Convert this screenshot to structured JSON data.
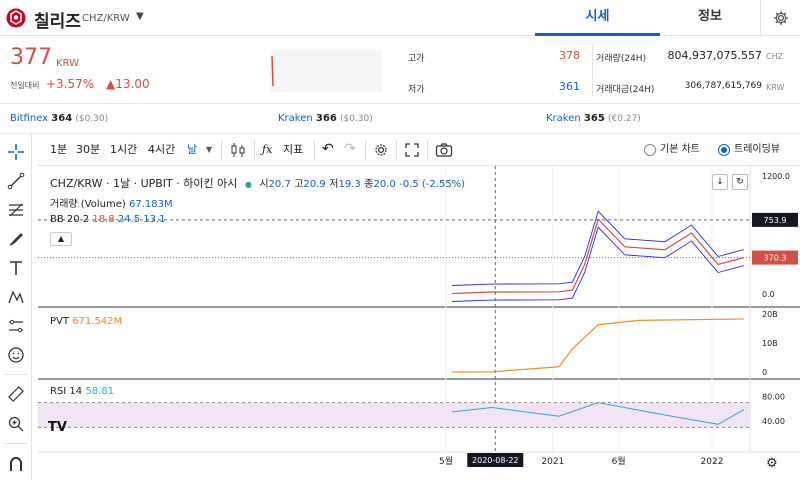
{
  "header": {
    "coin_name": "칠리즈",
    "pair": "CHZ/KRW",
    "tab_quote": "시세",
    "tab_info": "정보"
  },
  "summary": {
    "price": "377",
    "price_unit": "KRW",
    "change_label": "전일대비",
    "change_pct": "+3.57%",
    "change_abs": "▲13.00",
    "high_label": "고가",
    "high": "378",
    "low_label": "저가",
    "low": "361",
    "volume_label": "거래량(24H)",
    "volume": "804,937,075.557",
    "volume_unit": "CHZ",
    "amount_label": "거래대금(24H)",
    "amount": "306,787,615,769",
    "amount_unit": "KRW"
  },
  "exchanges": [
    {
      "name": "Bitfinex",
      "price": "364",
      "diff": "($0.30)"
    },
    {
      "name": "Kraken",
      "price": "366",
      "diff": "($0.30)"
    },
    {
      "name": "Kraken",
      "price": "365",
      "diff": "(€0.27)"
    }
  ],
  "toolbar": {
    "intervals": [
      "1분",
      "30분",
      "1시간",
      "4시간",
      "날"
    ],
    "indicators_label": "지표",
    "basic_chart": "기본 차트",
    "trading_view": "트레이딩뷰"
  },
  "legend": {
    "symbol": "CHZ/KRW · 1날 · UPBIT · 하이킨 아시",
    "o_lbl": "시",
    "o": "20.7",
    "h_lbl": "고",
    "h": "20.9",
    "l_lbl": "저",
    "l": "19.3",
    "c_lbl": "종",
    "c": "20.0",
    "chg": "-0.5 (-2.55%)",
    "volume_label": "거래량 (Volume)",
    "volume": "67.183M",
    "bb_label": "BB 20 2",
    "bb1": "18.8",
    "bb2": "24.5",
    "bb3": "13.1",
    "pvt_label": "PVT",
    "pvt": "671.542M",
    "rsi_label": "RSI 14",
    "rsi": "58.81"
  },
  "price_axis": {
    "ticks": [
      "1200.0",
      "0.0"
    ],
    "crosshair_value": "753.9",
    "last_value": "370.3"
  },
  "pvt_axis": {
    "ticks": [
      "20B",
      "10B",
      "0"
    ]
  },
  "rsi_axis": {
    "ticks": [
      "80.00",
      "40.00"
    ]
  },
  "time_axis": {
    "ticks": [
      "5월",
      "2021",
      "6월",
      "2022"
    ],
    "crosshair_date": "2020-08-22"
  },
  "colors": {
    "up": "#d24f45",
    "down": "#1261c4",
    "bb": "#2b2bd8",
    "pvt": "#f28c28",
    "rsi": "#35a8d6",
    "rsi_band": "#f1e4f4"
  },
  "chart_data": [
    {
      "type": "line",
      "title": "CHZ/KRW · 1날 · UPBIT · 하이킨 아시",
      "x": [
        "2020-05",
        "2020-08",
        "2020-11",
        "2021-01",
        "2021-02",
        "2021-03",
        "2021-04",
        "2021-06",
        "2021-09",
        "2021-11",
        "2022-01",
        "2022-03"
      ],
      "series": [
        {
          "name": "CHZ/KRW",
          "values": [
            5,
            20,
            21,
            22,
            40,
            300,
            760,
            480,
            450,
            620,
            300,
            370
          ]
        }
      ],
      "ylim": [
        0,
        1200
      ]
    },
    {
      "type": "line",
      "title": "PVT",
      "x": [
        "2020-05",
        "2020-08",
        "2021-01",
        "2021-02",
        "2021-04",
        "2021-07",
        "2022-03"
      ],
      "series": [
        {
          "name": "PVT",
          "values": [
            0,
            0.05,
            1.8,
            8,
            16.3,
            17.8,
            18.3
          ]
        }
      ],
      "ylim": [
        0,
        20
      ]
    },
    {
      "type": "line",
      "title": "RSI 14",
      "x": [
        "2020-05",
        "2020-08",
        "2021-01",
        "2021-04",
        "2021-09",
        "2022-01",
        "2022-03"
      ],
      "series": [
        {
          "name": "RSI 14",
          "values": [
            55,
            62,
            48,
            70,
            50,
            35,
            58.81
          ]
        }
      ],
      "ylim": [
        0,
        100
      ]
    }
  ]
}
